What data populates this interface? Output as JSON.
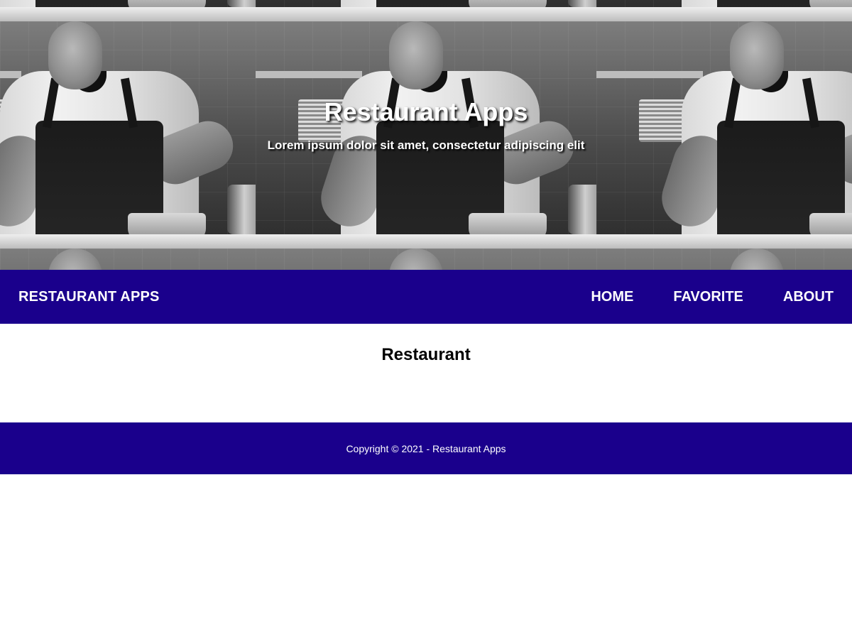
{
  "hero": {
    "title": "Restaurant Apps",
    "subtitle": "Lorem ipsum dolor sit amet, consectetur adipiscing elit",
    "image": "chef-cooking-photo"
  },
  "navbar": {
    "brand": "RESTAURANT APPS",
    "items": [
      {
        "label": "HOME"
      },
      {
        "label": "FAVORITE"
      },
      {
        "label": "ABOUT"
      }
    ]
  },
  "main": {
    "title": "Restaurant"
  },
  "footer": {
    "text": "Copyright © 2021 - Restaurant Apps"
  },
  "colors": {
    "primary": "#1a008c",
    "text_light": "#ffffff",
    "text_dark": "#000000"
  }
}
